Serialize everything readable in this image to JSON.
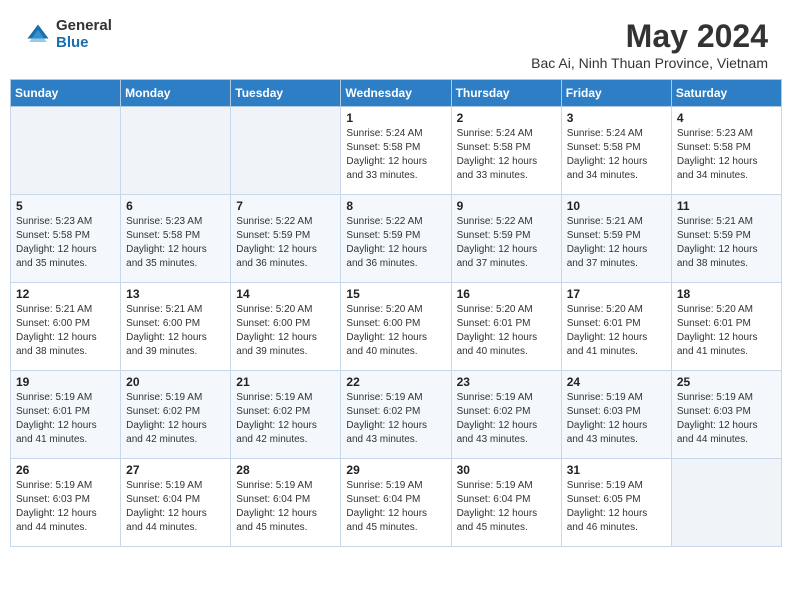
{
  "header": {
    "logo_general": "General",
    "logo_blue": "Blue",
    "main_title": "May 2024",
    "subtitle": "Bac Ai, Ninh Thuan Province, Vietnam"
  },
  "days_of_week": [
    "Sunday",
    "Monday",
    "Tuesday",
    "Wednesday",
    "Thursday",
    "Friday",
    "Saturday"
  ],
  "weeks": [
    [
      {
        "day": "",
        "info": ""
      },
      {
        "day": "",
        "info": ""
      },
      {
        "day": "",
        "info": ""
      },
      {
        "day": "1",
        "info": "Sunrise: 5:24 AM\nSunset: 5:58 PM\nDaylight: 12 hours\nand 33 minutes."
      },
      {
        "day": "2",
        "info": "Sunrise: 5:24 AM\nSunset: 5:58 PM\nDaylight: 12 hours\nand 33 minutes."
      },
      {
        "day": "3",
        "info": "Sunrise: 5:24 AM\nSunset: 5:58 PM\nDaylight: 12 hours\nand 34 minutes."
      },
      {
        "day": "4",
        "info": "Sunrise: 5:23 AM\nSunset: 5:58 PM\nDaylight: 12 hours\nand 34 minutes."
      }
    ],
    [
      {
        "day": "5",
        "info": "Sunrise: 5:23 AM\nSunset: 5:58 PM\nDaylight: 12 hours\nand 35 minutes."
      },
      {
        "day": "6",
        "info": "Sunrise: 5:23 AM\nSunset: 5:58 PM\nDaylight: 12 hours\nand 35 minutes."
      },
      {
        "day": "7",
        "info": "Sunrise: 5:22 AM\nSunset: 5:59 PM\nDaylight: 12 hours\nand 36 minutes."
      },
      {
        "day": "8",
        "info": "Sunrise: 5:22 AM\nSunset: 5:59 PM\nDaylight: 12 hours\nand 36 minutes."
      },
      {
        "day": "9",
        "info": "Sunrise: 5:22 AM\nSunset: 5:59 PM\nDaylight: 12 hours\nand 37 minutes."
      },
      {
        "day": "10",
        "info": "Sunrise: 5:21 AM\nSunset: 5:59 PM\nDaylight: 12 hours\nand 37 minutes."
      },
      {
        "day": "11",
        "info": "Sunrise: 5:21 AM\nSunset: 5:59 PM\nDaylight: 12 hours\nand 38 minutes."
      }
    ],
    [
      {
        "day": "12",
        "info": "Sunrise: 5:21 AM\nSunset: 6:00 PM\nDaylight: 12 hours\nand 38 minutes."
      },
      {
        "day": "13",
        "info": "Sunrise: 5:21 AM\nSunset: 6:00 PM\nDaylight: 12 hours\nand 39 minutes."
      },
      {
        "day": "14",
        "info": "Sunrise: 5:20 AM\nSunset: 6:00 PM\nDaylight: 12 hours\nand 39 minutes."
      },
      {
        "day": "15",
        "info": "Sunrise: 5:20 AM\nSunset: 6:00 PM\nDaylight: 12 hours\nand 40 minutes."
      },
      {
        "day": "16",
        "info": "Sunrise: 5:20 AM\nSunset: 6:01 PM\nDaylight: 12 hours\nand 40 minutes."
      },
      {
        "day": "17",
        "info": "Sunrise: 5:20 AM\nSunset: 6:01 PM\nDaylight: 12 hours\nand 41 minutes."
      },
      {
        "day": "18",
        "info": "Sunrise: 5:20 AM\nSunset: 6:01 PM\nDaylight: 12 hours\nand 41 minutes."
      }
    ],
    [
      {
        "day": "19",
        "info": "Sunrise: 5:19 AM\nSunset: 6:01 PM\nDaylight: 12 hours\nand 41 minutes."
      },
      {
        "day": "20",
        "info": "Sunrise: 5:19 AM\nSunset: 6:02 PM\nDaylight: 12 hours\nand 42 minutes."
      },
      {
        "day": "21",
        "info": "Sunrise: 5:19 AM\nSunset: 6:02 PM\nDaylight: 12 hours\nand 42 minutes."
      },
      {
        "day": "22",
        "info": "Sunrise: 5:19 AM\nSunset: 6:02 PM\nDaylight: 12 hours\nand 43 minutes."
      },
      {
        "day": "23",
        "info": "Sunrise: 5:19 AM\nSunset: 6:02 PM\nDaylight: 12 hours\nand 43 minutes."
      },
      {
        "day": "24",
        "info": "Sunrise: 5:19 AM\nSunset: 6:03 PM\nDaylight: 12 hours\nand 43 minutes."
      },
      {
        "day": "25",
        "info": "Sunrise: 5:19 AM\nSunset: 6:03 PM\nDaylight: 12 hours\nand 44 minutes."
      }
    ],
    [
      {
        "day": "26",
        "info": "Sunrise: 5:19 AM\nSunset: 6:03 PM\nDaylight: 12 hours\nand 44 minutes."
      },
      {
        "day": "27",
        "info": "Sunrise: 5:19 AM\nSunset: 6:04 PM\nDaylight: 12 hours\nand 44 minutes."
      },
      {
        "day": "28",
        "info": "Sunrise: 5:19 AM\nSunset: 6:04 PM\nDaylight: 12 hours\nand 45 minutes."
      },
      {
        "day": "29",
        "info": "Sunrise: 5:19 AM\nSunset: 6:04 PM\nDaylight: 12 hours\nand 45 minutes."
      },
      {
        "day": "30",
        "info": "Sunrise: 5:19 AM\nSunset: 6:04 PM\nDaylight: 12 hours\nand 45 minutes."
      },
      {
        "day": "31",
        "info": "Sunrise: 5:19 AM\nSunset: 6:05 PM\nDaylight: 12 hours\nand 46 minutes."
      },
      {
        "day": "",
        "info": ""
      }
    ]
  ]
}
